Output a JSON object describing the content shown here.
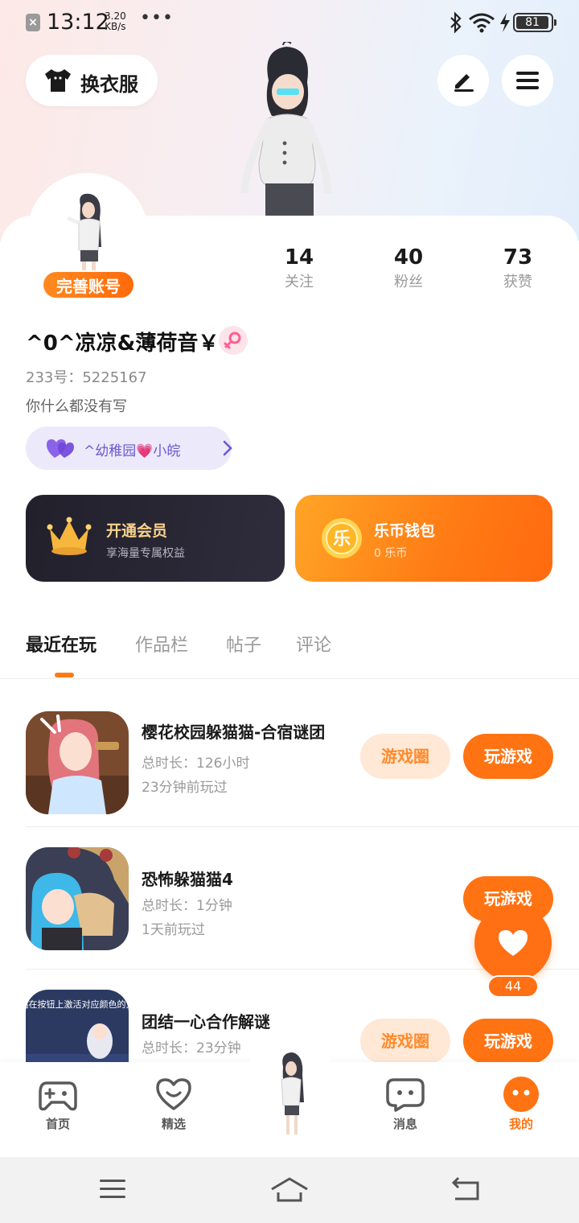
{
  "status_bar": {
    "time": "13:12",
    "speed_value": "3.20",
    "speed_unit": "KB/s",
    "battery": "81"
  },
  "header": {
    "change_outfit_label": "换衣服"
  },
  "profile": {
    "avatar_badge": "完善账号",
    "stats": [
      {
        "value": "14",
        "label": "关注"
      },
      {
        "value": "40",
        "label": "粉丝"
      },
      {
        "value": "73",
        "label": "获赞"
      }
    ],
    "nickname": "^0^凉凉&薄荷音￥",
    "uid": "233号：5225167",
    "bio": "你什么都没有写",
    "club": "^幼稚园💗小皖"
  },
  "cards": {
    "vip": {
      "title": "开通会员",
      "subtitle": "享海量专属权益"
    },
    "wallet": {
      "title": "乐币钱包",
      "subtitle": "0 乐币",
      "coin_char": "乐"
    }
  },
  "tabs": [
    "最近在玩",
    "作品栏",
    "帖子",
    "评论"
  ],
  "games": [
    {
      "name": "樱花校园躲猫猫-合宿谜团",
      "duration": "总时长：126小时",
      "last_played": "23分钟前玩过",
      "circle_label": "游戏圈",
      "play_label": "玩游戏"
    },
    {
      "name": "恐怖躲猫猫4",
      "duration": "总时长：1分钟",
      "last_played": "1天前玩过",
      "play_label": "玩游戏"
    },
    {
      "name": "团结一心合作解谜",
      "duration": "总时长：23分钟",
      "circle_label": "游戏圈",
      "play_label": "玩游戏",
      "thumb_text": "站在按钮上激活对应颜色的方"
    }
  ],
  "fab": {
    "count": "44"
  },
  "bottom_nav": [
    {
      "label": "首页"
    },
    {
      "label": "精选"
    },
    {
      "label": "消息"
    },
    {
      "label": "我的"
    }
  ],
  "colors": {
    "accent": "#ff7312",
    "vip_bg": "#22202b",
    "club_bg": "#ece9fb"
  }
}
